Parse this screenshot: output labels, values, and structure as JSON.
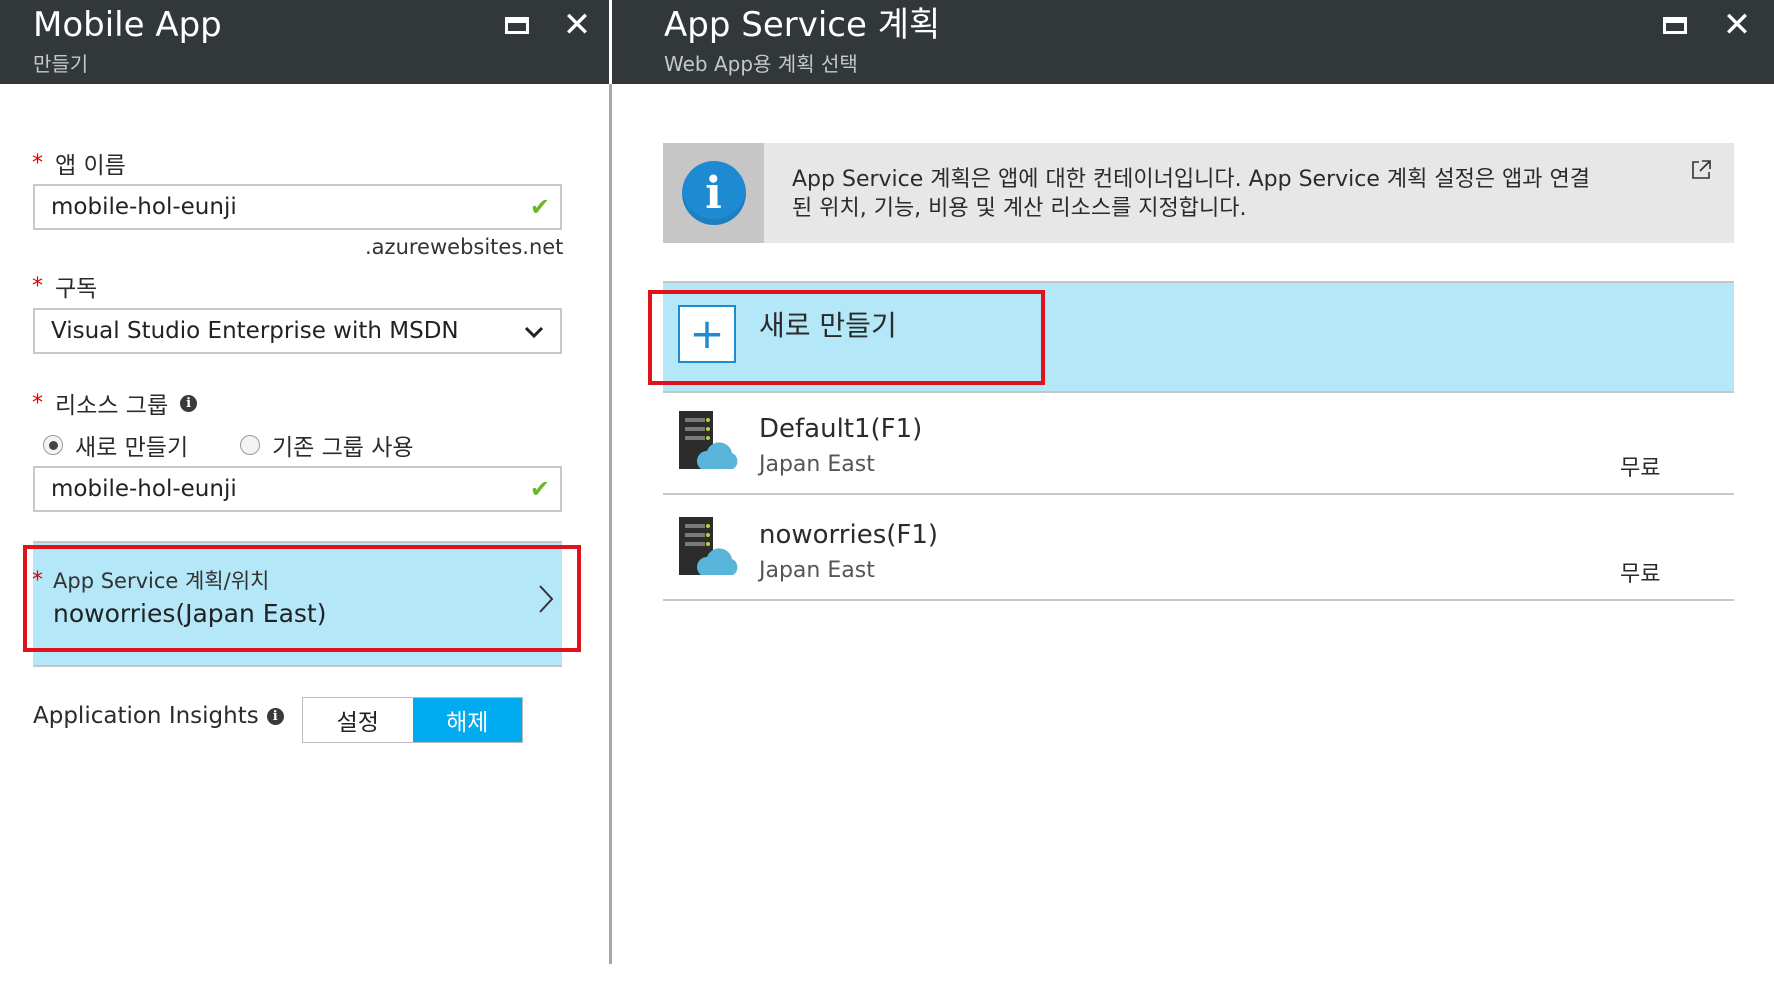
{
  "left_blade": {
    "title": "Mobile App",
    "subtitle": "만들기",
    "app_name": {
      "label": "앱 이름",
      "value": "mobile-hol-eunji",
      "suffix": ".azurewebsites.net"
    },
    "subscription": {
      "label": "구독",
      "value": "Visual Studio Enterprise with MSDN"
    },
    "resource_group": {
      "label": "리소스 그룹",
      "radio_create": "새로 만들기",
      "radio_existing": "기존 그룹 사용",
      "value": "mobile-hol-eunji"
    },
    "app_service_plan": {
      "label": "App Service 계획/위치",
      "value": "noworries(Japan East)"
    },
    "app_insights": {
      "label": "Application Insights",
      "on_label": "설정",
      "off_label": "해제",
      "selected": "해제"
    }
  },
  "right_blade": {
    "title": "App Service 계획",
    "subtitle": "Web App용 계획 선택",
    "info_line1": "App Service 계획은 앱에 대한 컨테이너입니다. App Service 계획 설정은 앱과 연결",
    "info_line2": "된 위치, 기능, 비용 및 계산 리소스를 지정합니다.",
    "create_new_label": "새로 만들기",
    "plans": [
      {
        "name": "Default1(F1)",
        "location": "Japan East",
        "price": "무료"
      },
      {
        "name": "noworries(F1)",
        "location": "Japan East",
        "price": "무료"
      }
    ]
  },
  "colors": {
    "header_bg": "#32373a",
    "selected_bg": "#b4e7f7",
    "highlight_red": "#e0121c",
    "toggle_active": "#00abf0",
    "valid_check": "#6bb72a",
    "info_blue": "#1e8ad2"
  }
}
